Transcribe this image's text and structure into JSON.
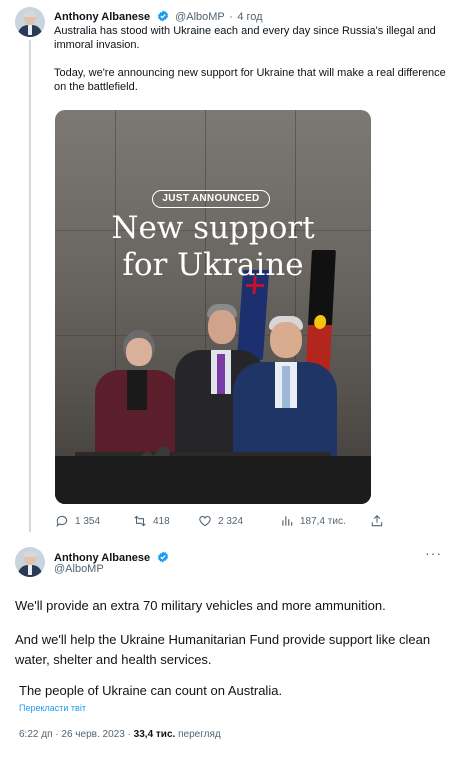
{
  "tweet1": {
    "author_name": "Anthony Albanese",
    "handle": "@AlboMP",
    "separator": "·",
    "time": "4 год",
    "paragraph1": "Australia has stood with Ukraine each and every day since Russia's illegal and immoral invasion.",
    "paragraph2": "Today, we're announcing new support for Ukraine that will make a real difference on the battlefield.",
    "media": {
      "badge": "JUST ANNOUNCED",
      "headline_line1": "New support",
      "headline_line2": "for Ukraine"
    },
    "actions": {
      "replies": "1 354",
      "retweets": "418",
      "likes": "2 324",
      "views": "187,4 тис."
    }
  },
  "tweet2": {
    "author_name": "Anthony Albanese",
    "handle": "@AlboMP",
    "paragraph1": "We'll provide an extra 70 military vehicles and more ammunition.",
    "paragraph2": "And we'll help the Ukraine Humanitarian Fund provide support like clean water, shelter and health services.",
    "paragraph3": "The people of Ukraine can count on Australia.",
    "translate_link": "Перекласти твіт",
    "meta": {
      "time": "6:22 дп",
      "separator": "·",
      "date": "26 черв. 2023",
      "separator2": "·",
      "views_count": "33,4 тис.",
      "views_label": "перегляд"
    }
  },
  "colors": {
    "verified": "#1d9bf0",
    "text": "#0f1419",
    "secondary": "#536471",
    "link": "#1d9bf0"
  }
}
